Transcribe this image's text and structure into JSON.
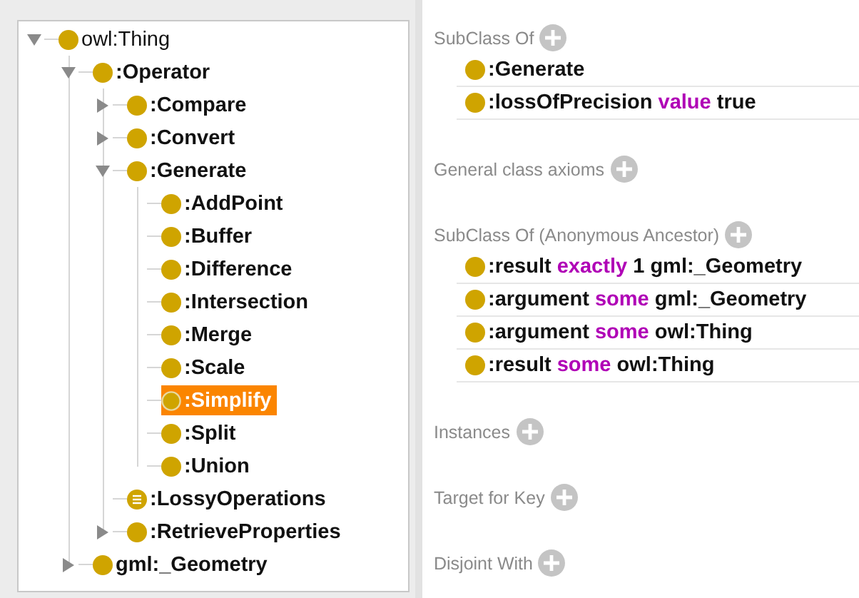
{
  "class_tree": [
    {
      "label": "owl:Thing",
      "kind": "class",
      "bold": false,
      "expanded": true,
      "selected": false,
      "children": [
        {
          "label": ":Operator",
          "kind": "class",
          "bold": true,
          "expanded": true,
          "selected": false,
          "children": [
            {
              "label": ":Compare",
              "kind": "class",
              "bold": true,
              "expanded": false,
              "selected": false
            },
            {
              "label": ":Convert",
              "kind": "class",
              "bold": true,
              "expanded": false,
              "selected": false
            },
            {
              "label": ":Generate",
              "kind": "class",
              "bold": true,
              "expanded": true,
              "selected": false,
              "children": [
                {
                  "label": ":AddPoint",
                  "kind": "class",
                  "bold": true,
                  "selected": false
                },
                {
                  "label": ":Buffer",
                  "kind": "class",
                  "bold": true,
                  "selected": false
                },
                {
                  "label": ":Difference",
                  "kind": "class",
                  "bold": true,
                  "selected": false
                },
                {
                  "label": ":Intersection",
                  "kind": "class",
                  "bold": true,
                  "selected": false
                },
                {
                  "label": ":Merge",
                  "kind": "class",
                  "bold": true,
                  "selected": false
                },
                {
                  "label": ":Scale",
                  "kind": "class",
                  "bold": true,
                  "selected": false
                },
                {
                  "label": ":Simplify",
                  "kind": "class",
                  "bold": true,
                  "selected": true
                },
                {
                  "label": ":Split",
                  "kind": "class",
                  "bold": true,
                  "selected": false
                },
                {
                  "label": ":Union",
                  "kind": "class",
                  "bold": true,
                  "selected": false
                }
              ]
            },
            {
              "label": ":LossyOperations",
              "kind": "defined",
              "bold": true,
              "selected": false
            },
            {
              "label": ":RetrieveProperties",
              "kind": "class",
              "bold": true,
              "expanded": false,
              "selected": false
            }
          ]
        },
        {
          "label": "gml:_Geometry",
          "kind": "class",
          "bold": true,
          "expanded": false,
          "selected": false
        }
      ]
    }
  ],
  "description_sections": [
    {
      "title": "SubClass Of",
      "axioms": [
        [
          {
            "text": ":Generate",
            "kind": "entity"
          }
        ],
        [
          {
            "text": ":lossOfPrecision",
            "kind": "entity"
          },
          {
            "text": "value",
            "kind": "keyword"
          },
          {
            "text": "true",
            "kind": "literal"
          }
        ]
      ]
    },
    {
      "title": "General class axioms"
    },
    {
      "title": "SubClass Of (Anonymous Ancestor)",
      "axioms": [
        [
          {
            "text": ":result",
            "kind": "entity"
          },
          {
            "text": "exactly",
            "kind": "keyword"
          },
          {
            "text": "1",
            "kind": "literal"
          },
          {
            "text": "gml:_Geometry",
            "kind": "entity"
          }
        ],
        [
          {
            "text": ":argument",
            "kind": "entity"
          },
          {
            "text": "some",
            "kind": "keyword"
          },
          {
            "text": "gml:_Geometry",
            "kind": "entity"
          }
        ],
        [
          {
            "text": ":argument",
            "kind": "entity"
          },
          {
            "text": "some",
            "kind": "keyword"
          },
          {
            "text": "owl:Thing",
            "kind": "entity"
          }
        ],
        [
          {
            "text": ":result",
            "kind": "entity"
          },
          {
            "text": "some",
            "kind": "keyword"
          },
          {
            "text": "owl:Thing",
            "kind": "entity"
          }
        ]
      ]
    },
    {
      "title": "Instances"
    },
    {
      "title": "Target for Key"
    },
    {
      "title": "Disjoint With"
    }
  ]
}
